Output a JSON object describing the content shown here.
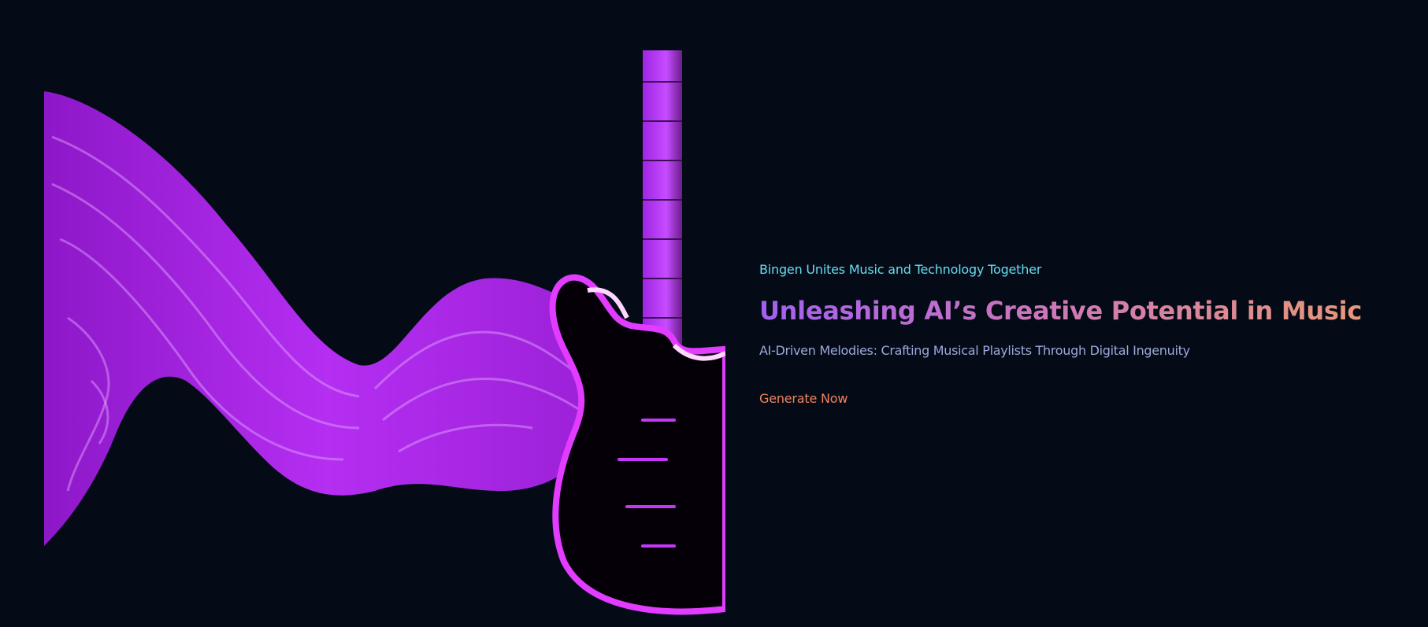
{
  "hero": {
    "eyebrow": "Bingen Unites Music and Technology Together",
    "title": "Unleashing AI’s Creative Potential in Music",
    "subtitle": "AI-Driven Melodies: Crafting Musical Playlists Through Digital Ingenuity",
    "cta_label": "Generate Now"
  },
  "colors": {
    "background": "#040b17",
    "eyebrow": "#67dcf0",
    "title_gradient_start": "#a45ff1",
    "title_gradient_end": "#eb9a72",
    "subtitle": "#9aa9da",
    "cta": "#f2835c",
    "art_purple": "#b422f0"
  }
}
